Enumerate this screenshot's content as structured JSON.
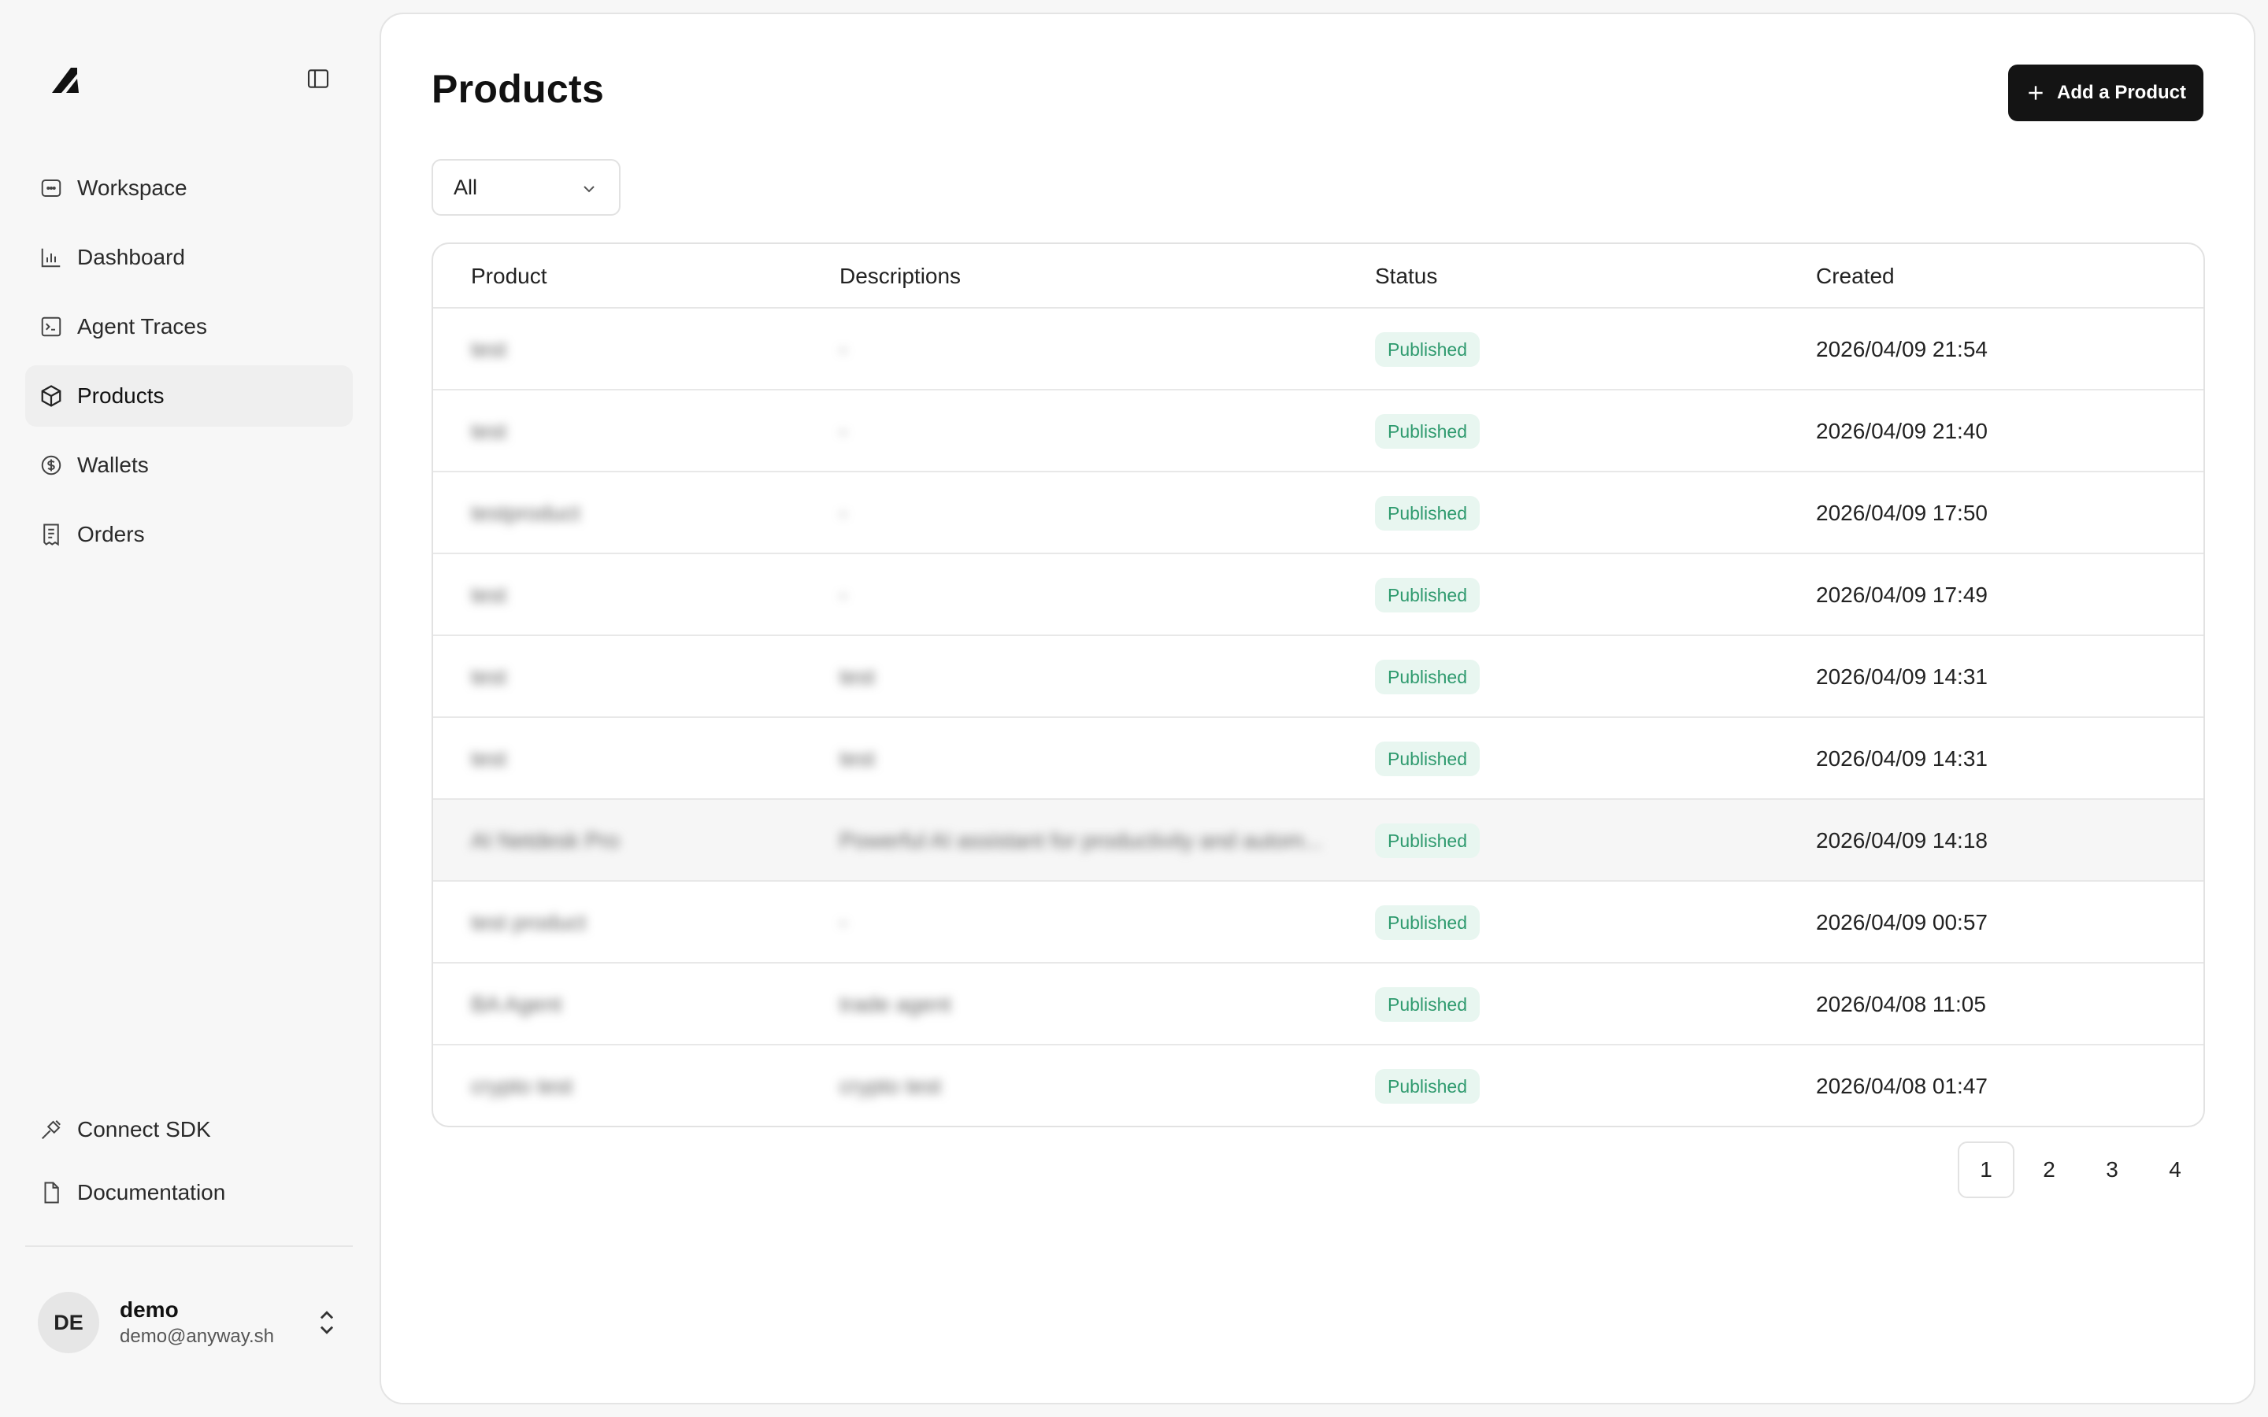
{
  "sidebar": {
    "nav": [
      {
        "label": "Workspace",
        "icon": "workspace-icon"
      },
      {
        "label": "Dashboard",
        "icon": "bar-chart-icon"
      },
      {
        "label": "Agent Traces",
        "icon": "terminal-icon"
      },
      {
        "label": "Products",
        "icon": "box-icon"
      },
      {
        "label": "Wallets",
        "icon": "dollar-circle-icon"
      },
      {
        "label": "Orders",
        "icon": "receipt-icon"
      }
    ],
    "bottom": [
      {
        "label": "Connect SDK",
        "icon": "plug-icon"
      },
      {
        "label": "Documentation",
        "icon": "document-icon"
      }
    ],
    "user": {
      "initials": "DE",
      "name": "demo",
      "email": "demo@anyway.sh"
    }
  },
  "main": {
    "title": "Products",
    "add_button": "Add a Product",
    "filter": {
      "selected": "All"
    },
    "table": {
      "headers": [
        "Product",
        "Descriptions",
        "Status",
        "Created"
      ],
      "rows": [
        {
          "product": "test",
          "description": "-",
          "status": "Published",
          "created": "2026/04/09 21:54"
        },
        {
          "product": "test",
          "description": "-",
          "status": "Published",
          "created": "2026/04/09 21:40"
        },
        {
          "product": "testproduct",
          "description": "-",
          "status": "Published",
          "created": "2026/04/09 17:50"
        },
        {
          "product": "test",
          "description": "-",
          "status": "Published",
          "created": "2026/04/09 17:49"
        },
        {
          "product": "test",
          "description": "test",
          "status": "Published",
          "created": "2026/04/09 14:31"
        },
        {
          "product": "test",
          "description": "test",
          "status": "Published",
          "created": "2026/04/09 14:31"
        },
        {
          "product": "AI Netdesk Pro",
          "description": "Powerful AI assistant for productivity and autom...",
          "status": "Published",
          "created": "2026/04/09 14:18"
        },
        {
          "product": "test product",
          "description": "-",
          "status": "Published",
          "created": "2026/04/09 00:57"
        },
        {
          "product": "BA Agent",
          "description": "trade agent",
          "status": "Published",
          "created": "2026/04/08 11:05"
        },
        {
          "product": "crypto test",
          "description": "crypto test",
          "status": "Published",
          "created": "2026/04/08 01:47"
        }
      ]
    },
    "pagination": [
      "1",
      "2",
      "3",
      "4"
    ],
    "current_page": "1"
  },
  "colors": {
    "accent": "#141414",
    "badge_bg": "#e8f6f0",
    "badge_text": "#2e9a6e",
    "background": "#f7f7f7"
  }
}
